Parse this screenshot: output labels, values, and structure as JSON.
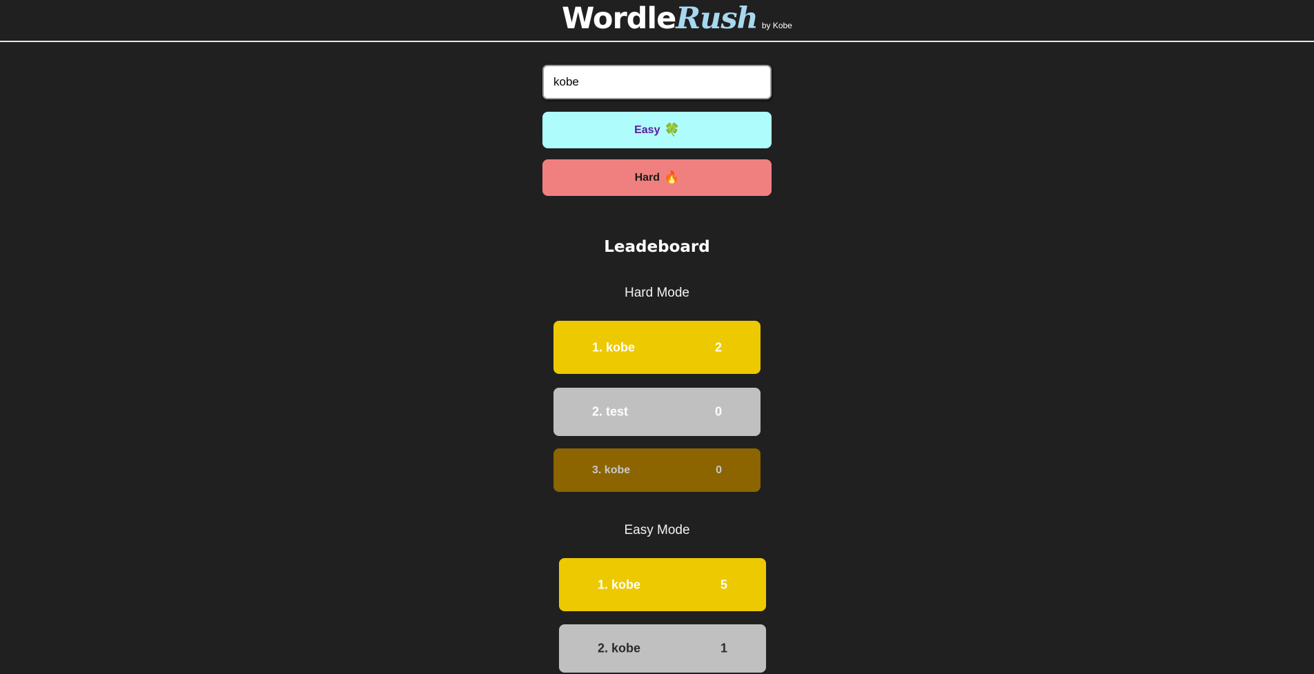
{
  "header": {
    "brand_wordle": "Wordle",
    "brand_rush": "Rush",
    "brand_by": "by Kobe"
  },
  "form": {
    "name_value": "kobe",
    "easy_label": "Easy",
    "easy_emoji": "🍀",
    "hard_label": "Hard",
    "hard_emoji": "🔥"
  },
  "leaderboard": {
    "title": "Leadeboard",
    "hard": {
      "title": "Hard Mode",
      "rows": [
        {
          "rank_name": "1. kobe",
          "score": "2"
        },
        {
          "rank_name": "2. test",
          "score": "0"
        },
        {
          "rank_name": "3. kobe",
          "score": "0"
        }
      ]
    },
    "easy": {
      "title": "Easy Mode",
      "rows": [
        {
          "rank_name": "1. kobe",
          "score": "5"
        },
        {
          "rank_name": "2. kobe",
          "score": "1"
        }
      ]
    }
  },
  "colors": {
    "background": "#202020",
    "gold": "#ecc900",
    "silver": "#c0c0c0",
    "bronze": "#8c6400",
    "easy_button": "#aefcfc",
    "hard_button": "#f08080",
    "rush_accent": "#a8d8f0"
  }
}
